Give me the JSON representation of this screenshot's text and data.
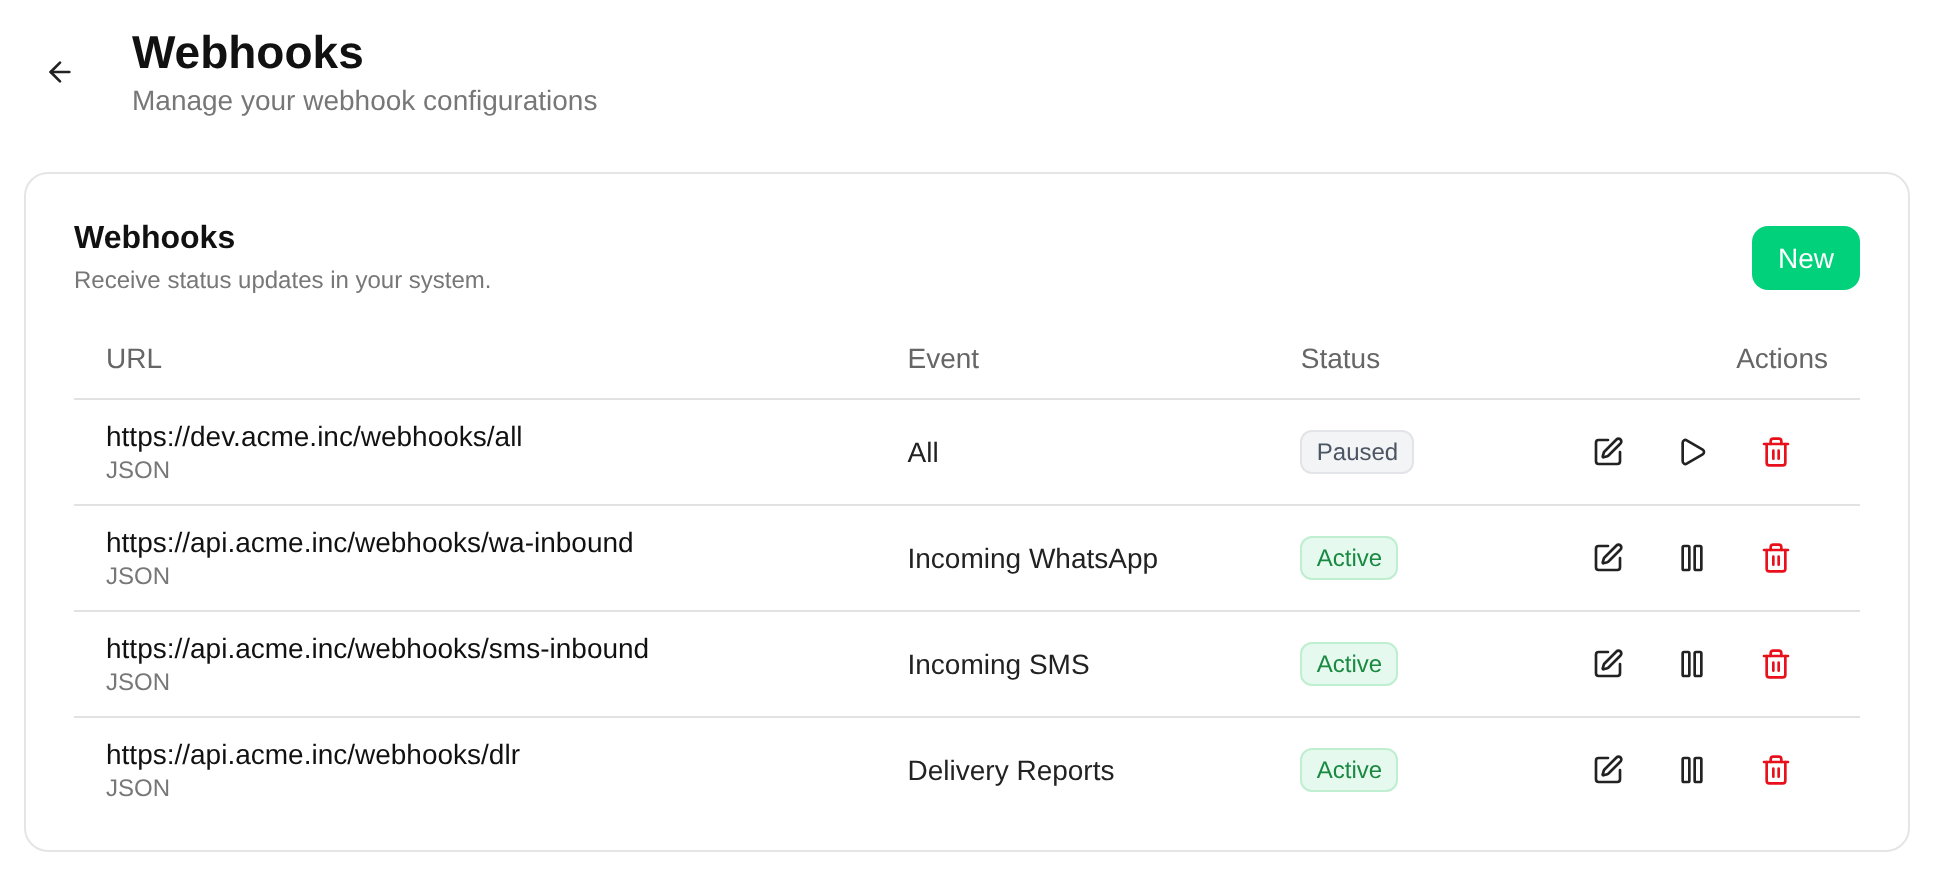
{
  "header": {
    "title": "Webhooks",
    "subtitle": "Manage your webhook configurations"
  },
  "card": {
    "title": "Webhooks",
    "subtitle": "Receive status updates in your system.",
    "new_button": "New"
  },
  "table": {
    "columns": [
      "URL",
      "Event",
      "Status",
      "Actions"
    ],
    "rows": [
      {
        "url": "https://dev.acme.inc/webhooks/all",
        "format": "JSON",
        "event": "All",
        "status": {
          "kind": "paused",
          "label": "Paused"
        }
      },
      {
        "url": "https://api.acme.inc/webhooks/wa-inbound",
        "format": "JSON",
        "event": "Incoming WhatsApp",
        "status": {
          "kind": "active",
          "label": "Active"
        }
      },
      {
        "url": "https://api.acme.inc/webhooks/sms-inbound",
        "format": "JSON",
        "event": "Incoming SMS",
        "status": {
          "kind": "active",
          "label": "Active"
        }
      },
      {
        "url": "https://api.acme.inc/webhooks/dlr",
        "format": "JSON",
        "event": "Delivery Reports",
        "status": {
          "kind": "active",
          "label": "Active"
        }
      }
    ]
  }
}
